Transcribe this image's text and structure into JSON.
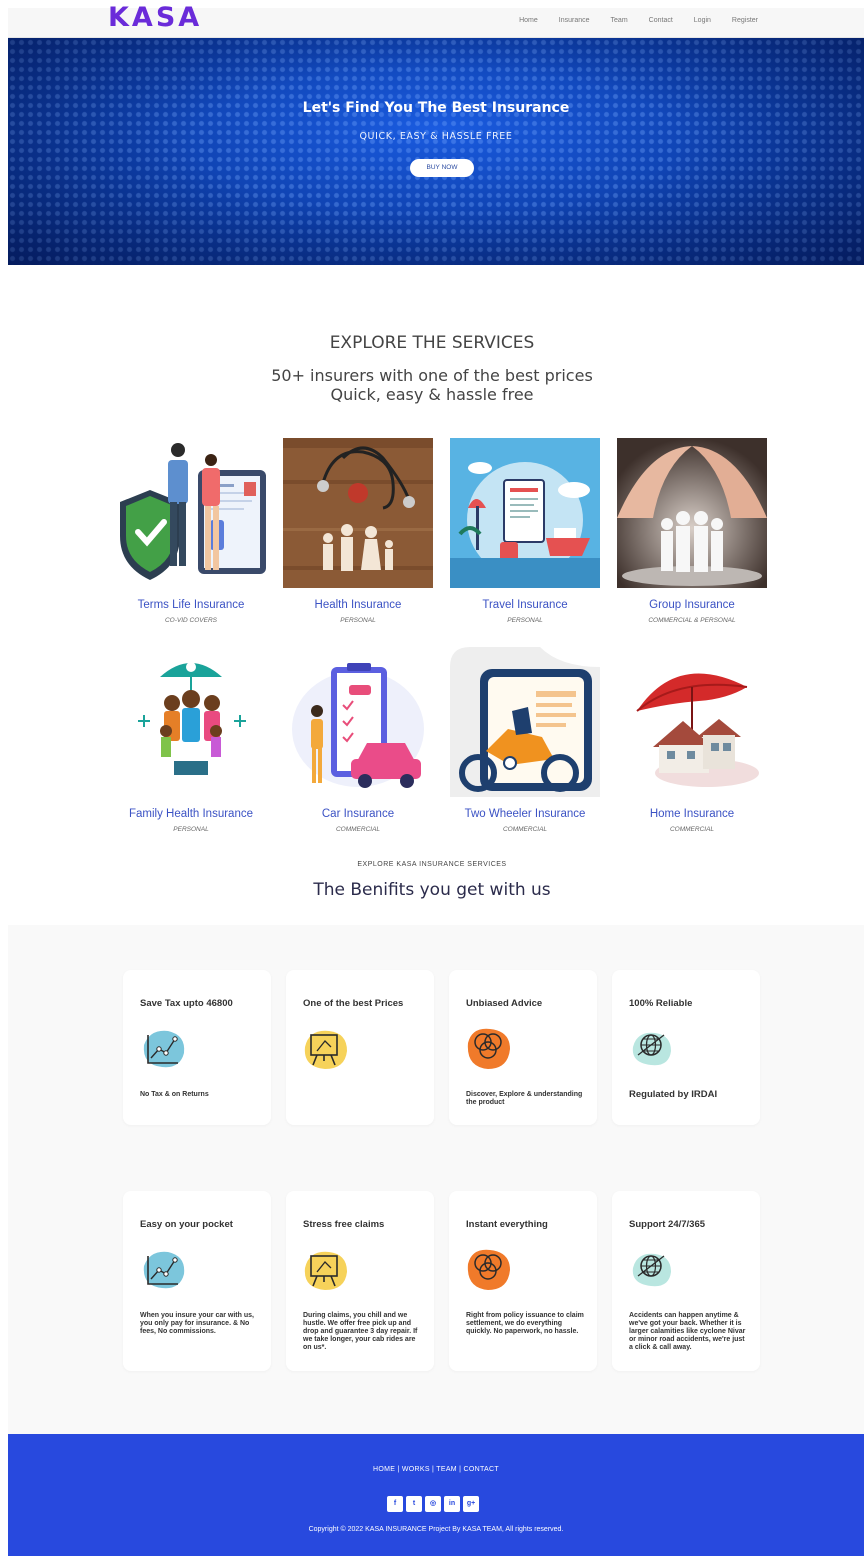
{
  "brand": {
    "logo": "KASA",
    "accent": "#6a2bd9"
  },
  "nav": {
    "items": [
      {
        "label": "Home"
      },
      {
        "label": "Insurance"
      },
      {
        "label": "Team"
      },
      {
        "label": "Contact"
      },
      {
        "label": "Login"
      },
      {
        "label": "Register"
      }
    ]
  },
  "hero": {
    "title": "Let's Find You The Best Insurance",
    "subtitle": "QUICK, EASY & HASSLE FREE",
    "button": "BUY NOW",
    "bg_color": "#0b3aa6"
  },
  "explore": {
    "title": "EXPLORE THE SERVICES",
    "subtitle_line1": "50+ insurers with one of the best prices",
    "subtitle_line2": "Quick, easy & hassle free"
  },
  "services": [
    {
      "name": "Terms Life Insurance",
      "tag": "CO-VID COVERS",
      "icon": "family-shield-illustration"
    },
    {
      "name": "Health Insurance",
      "tag": "PERSONAL",
      "icon": "stethoscope-family-photo"
    },
    {
      "name": "Travel Insurance",
      "tag": "PERSONAL",
      "icon": "travel-illustration"
    },
    {
      "name": "Group Insurance",
      "tag": "COMMERCIAL & PERSONAL",
      "icon": "hands-protecting-people-photo"
    },
    {
      "name": "Family Health Insurance",
      "tag": "PERSONAL",
      "icon": "family-umbrella-illustration"
    },
    {
      "name": "Car Insurance",
      "tag": "COMMERCIAL",
      "icon": "car-clipboard-illustration"
    },
    {
      "name": "Two Wheeler Insurance",
      "tag": "COMMERCIAL",
      "icon": "motorbike-illustration"
    },
    {
      "name": "Home Insurance",
      "tag": "COMMERCIAL",
      "icon": "house-umbrella-photo"
    }
  ],
  "benefits": {
    "kicker": "EXPLORE KASA INSURANCE SERVICES",
    "title": "The Benifits you get with us",
    "items": [
      {
        "title": "Save Tax upto 46800",
        "text": "No Tax & on Returns",
        "icon": "chart-icon",
        "blob": "#7cc6dc"
      },
      {
        "title": "One of the best Prices",
        "text": "",
        "icon": "presentation-board-icon",
        "blob": "#f6d25a"
      },
      {
        "title": "Unbiased Advice",
        "text": "Discover, Explore & understanding the product",
        "icon": "venn-circles-icon",
        "blob": "#f07a2a"
      },
      {
        "title": "100% Reliable",
        "text": "Regulated by IRDAI",
        "icon": "globe-icon",
        "blob": "#b9e6e0"
      },
      {
        "title": "Easy on your pocket",
        "text": "When you insure your car with us, you only pay for insurance. & No fees, No commissions.",
        "icon": "chart-icon",
        "blob": "#7cc6dc"
      },
      {
        "title": "Stress free claims",
        "text": "During claims, you chill and we hustle. We offer free pick up and drop and guarantee 3 day repair. If we take longer, your cab rides are on us*.",
        "icon": "presentation-board-icon",
        "blob": "#f6d25a"
      },
      {
        "title": "Instant everything",
        "text": "Right from policy issuance to claim settlement, we do everything quickly. No paperwork, no hassle.",
        "icon": "venn-circles-icon",
        "blob": "#f07a2a"
      },
      {
        "title": "Support 24/7/365",
        "text": "Accidents can happen anytime & we've got your back. Whether it is larger calamities like cyclone Nivar or minor road accidents, we're just a click & call away.",
        "icon": "globe-icon",
        "blob": "#b9e6e0"
      }
    ]
  },
  "footer": {
    "links": "HOME | WORKS | TEAM | CONTACT",
    "socials": [
      {
        "glyph": "f",
        "icon": "facebook-icon"
      },
      {
        "glyph": "t",
        "icon": "twitter-icon"
      },
      {
        "glyph": "◎",
        "icon": "instagram-icon"
      },
      {
        "glyph": "in",
        "icon": "linkedin-icon"
      },
      {
        "glyph": "g+",
        "icon": "google-plus-icon"
      }
    ],
    "copyright": "Copyright © 2022 KASA INSURANCE Project By KASA TEAM, All rights reserved.",
    "bg_color": "#2849de"
  }
}
